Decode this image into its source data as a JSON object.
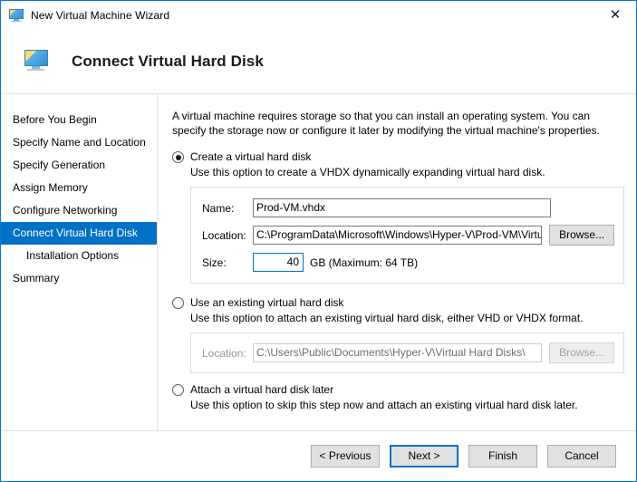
{
  "window": {
    "title": "New Virtual Machine Wizard",
    "title_icon": "monitor-icon",
    "close_label": "✕"
  },
  "header": {
    "title": "Connect Virtual Hard Disk",
    "icon": "monitor-icon"
  },
  "sidebar": {
    "items": [
      {
        "label": "Before You Begin",
        "selected": false,
        "sub": false
      },
      {
        "label": "Specify Name and Location",
        "selected": false,
        "sub": false
      },
      {
        "label": "Specify Generation",
        "selected": false,
        "sub": false
      },
      {
        "label": "Assign Memory",
        "selected": false,
        "sub": false
      },
      {
        "label": "Configure Networking",
        "selected": false,
        "sub": false
      },
      {
        "label": "Connect Virtual Hard Disk",
        "selected": true,
        "sub": false
      },
      {
        "label": "Installation Options",
        "selected": false,
        "sub": true
      },
      {
        "label": "Summary",
        "selected": false,
        "sub": false
      }
    ]
  },
  "main": {
    "intro": "A virtual machine requires storage so that you can install an operating system. You can specify the storage now or configure it later by modifying the virtual machine's properties.",
    "option_create": {
      "label": "Create a virtual hard disk",
      "selected": true,
      "description": "Use this option to create a VHDX dynamically expanding virtual hard disk.",
      "fields": {
        "name_label": "Name:",
        "name_value": "Prod-VM.vhdx",
        "location_label": "Location:",
        "location_value": "C:\\ProgramData\\Microsoft\\Windows\\Hyper-V\\Prod-VM\\Virtual Hard ",
        "browse_label": "Browse...",
        "size_label": "Size:",
        "size_value": "40",
        "size_units": "GB (Maximum: 64 TB)"
      }
    },
    "option_existing": {
      "label": "Use an existing virtual hard disk",
      "selected": false,
      "description": "Use this option to attach an existing virtual hard disk, either VHD or VHDX format.",
      "fields": {
        "location_label": "Location:",
        "location_value": "C:\\Users\\Public\\Documents\\Hyper-V\\Virtual Hard Disks\\",
        "browse_label": "Browse..."
      }
    },
    "option_later": {
      "label": "Attach a virtual hard disk later",
      "selected": false,
      "description": "Use this option to skip this step now and attach an existing virtual hard disk later."
    }
  },
  "footer": {
    "previous_label": "< Previous",
    "next_label": "Next >",
    "finish_label": "Finish",
    "cancel_label": "Cancel"
  },
  "colors": {
    "accent": "#0072c6",
    "window_border": "#0078d7",
    "selection": "#0072c6",
    "button_face": "#e1e1e1"
  }
}
